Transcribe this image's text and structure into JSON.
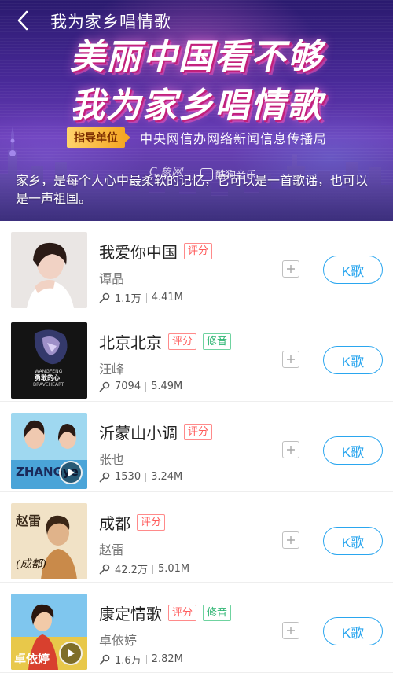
{
  "header": {
    "back_icon": "chevron-left-icon",
    "title": "我为家乡唱情歌"
  },
  "banner": {
    "headline_1": "美丽中国看不够",
    "headline_2": "我为家乡唱情歌",
    "guide_label": "指导单位",
    "guide_org": "中央网信办网络新闻信息传播局",
    "watermark_1": "C.象网",
    "watermark_2": "酷狗音乐",
    "description": "家乡，是每个人心中最柔软的记忆，它可以是一首歌谣，也可以是一声祖国。",
    "colors": {
      "accent_pink": "#c2207a",
      "bg_purple": "#4a2a9a",
      "tag_gold": "#f5a623"
    }
  },
  "songs": [
    {
      "title": "我爱你中国",
      "tags": [
        "评分"
      ],
      "artist": "谭晶",
      "plays": "1.1万",
      "size": "4.41M",
      "cover": "cover-tan-jing"
    },
    {
      "title": "北京北京",
      "tags": [
        "评分",
        "修音"
      ],
      "artist": "汪峰",
      "plays": "7094",
      "size": "5.49M",
      "cover": "cover-wang-feng"
    },
    {
      "title": "沂蒙山小调",
      "tags": [
        "评分"
      ],
      "artist": "张也",
      "plays": "1530",
      "size": "3.24M",
      "cover": "cover-zhang-ye"
    },
    {
      "title": "成都",
      "tags": [
        "评分"
      ],
      "artist": "赵雷",
      "plays": "42.2万",
      "size": "5.01M",
      "cover": "cover-zhao-lei"
    },
    {
      "title": "康定情歌",
      "tags": [
        "评分",
        "修音"
      ],
      "artist": "卓依婷",
      "plays": "1.6万",
      "size": "2.82M",
      "cover": "cover-zhuo-yiting"
    }
  ],
  "actions": {
    "k_label": "K歌",
    "add_icon": "plus-icon",
    "play_icon": "play-icon",
    "mic_icon": "microphone-icon"
  },
  "cover_text": {
    "wang_feng": "WANGFENG 勇敢的心 BRAVEHEART",
    "zhang_ye": "ZHANGye",
    "zhao_lei_1": "赵雷",
    "zhao_lei_2": "成都",
    "zhuo_yiting": "卓依婷"
  },
  "theme": {
    "k_blue": "#2aa6ef",
    "score_red": "#ff5a5a",
    "fix_green": "#2fb573"
  }
}
